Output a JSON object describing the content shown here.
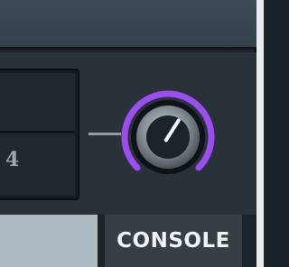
{
  "scene": {
    "number": "4"
  },
  "knob": {
    "accent_color": "#9b4df0",
    "level": 0.62
  },
  "console_button": {
    "label": "CONSOLE"
  },
  "colors": {
    "background": "#1d252b",
    "button": "#363f46",
    "fader": "#aebbc3"
  }
}
